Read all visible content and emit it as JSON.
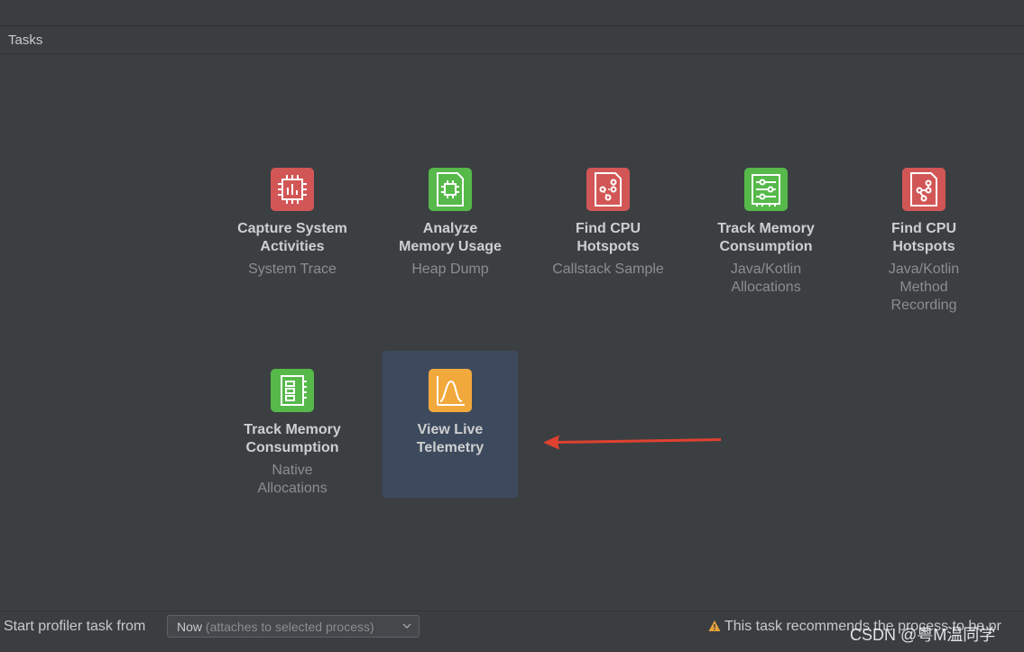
{
  "panel": {
    "title": "Tasks"
  },
  "tasks": [
    {
      "title1": "Capture System",
      "title2": "Activities",
      "sub1": "System Trace",
      "sub2": "",
      "sub3": "",
      "color": "#d25656",
      "icon": "cpu-chip-icon"
    },
    {
      "title1": "Analyze",
      "title2": "Memory Usage",
      "sub1": "Heap Dump",
      "sub2": "",
      "sub3": "",
      "color": "#56b94a",
      "icon": "memory-chip-icon"
    },
    {
      "title1": "Find CPU",
      "title2": "Hotspots",
      "sub1": "Callstack Sample",
      "sub2": "",
      "sub3": "",
      "color": "#d25656",
      "icon": "callstack-file-icon"
    },
    {
      "title1": "Track Memory",
      "title2": "Consumption",
      "sub1": "Java/Kotlin",
      "sub2": "Allocations",
      "sub3": "",
      "color": "#56b94a",
      "icon": "memory-module-icon"
    },
    {
      "title1": "Find CPU",
      "title2": "Hotspots",
      "sub1": "Java/Kotlin",
      "sub2": "Method",
      "sub3": "Recording",
      "color": "#d25656",
      "icon": "method-trace-file-icon"
    },
    {
      "title1": "Track Memory",
      "title2": "Consumption",
      "sub1": "Native",
      "sub2": "Allocations",
      "sub3": "",
      "color": "#56b94a",
      "icon": "native-memory-icon"
    },
    {
      "title1": "View Live",
      "title2": "Telemetry",
      "sub1": "",
      "sub2": "",
      "sub3": "",
      "color": "#f2a93b",
      "icon": "live-chart-icon"
    }
  ],
  "bottom": {
    "label": "Start profiler task from",
    "dropdown_value": "Now",
    "dropdown_hint": "(attaches to selected process)",
    "warning": "This task recommends the process to be pr"
  },
  "watermark": "CSDN @粤M温同学",
  "colors": {
    "selected": "#3d4a5e",
    "arrow": "#e0412f"
  }
}
